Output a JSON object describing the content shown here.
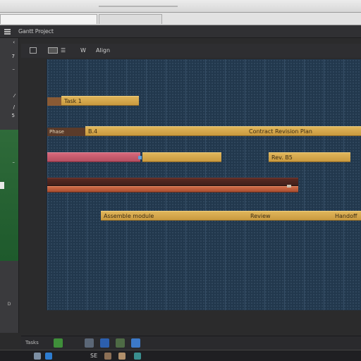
{
  "window": {
    "title": "",
    "tabs": [
      "",
      ""
    ]
  },
  "app": {
    "title": "Gantt Project"
  },
  "sidebar": {
    "items": [
      {
        "label": "‹"
      },
      {
        "label": "7"
      },
      {
        "label": "–"
      },
      {
        "label": "⁄"
      },
      {
        "label": "/"
      },
      {
        "label": "5"
      },
      {
        "label": ""
      },
      {
        "label": "–"
      },
      {
        "label": ""
      }
    ],
    "bottom_labels": [
      "D",
      "",
      ""
    ]
  },
  "toolbar": {
    "items": [
      {
        "icon": "grid-icon",
        "label": ""
      },
      {
        "icon": "calendar-icon",
        "label": "☰"
      },
      {
        "icon": "view-icon",
        "label": "W"
      },
      {
        "icon": "",
        "label": "Align"
      }
    ]
  },
  "gantt": {
    "rows": [
      {
        "label": "",
        "bar_text": "Task 1"
      },
      {
        "label": "Phase",
        "bar_text": "B.4",
        "bar2_text": "Contract Revision Plan"
      },
      {
        "label": "",
        "bar_text": "",
        "bar2_text": "Rev. B5"
      },
      {
        "label": "",
        "bar_text": ""
      },
      {
        "label": "",
        "bar_text": "Assemble module",
        "bar2_text": "Review",
        "bar3_text": "Handoff"
      }
    ]
  },
  "status": {
    "text": "Tasks"
  },
  "taskbar": {
    "text": "SE"
  },
  "colors": {
    "gantt_bg": "#22384d",
    "bar_gold": "#d4a64b",
    "bar_pink": "#c65a6d",
    "bar_dark": "#4d251e",
    "sidebar_green": "#2a6436"
  }
}
